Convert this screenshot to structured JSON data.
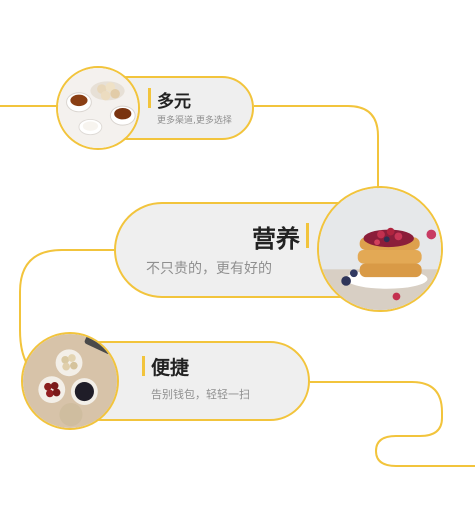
{
  "colors": {
    "accent": "#f2c43c",
    "pill": "#efefef",
    "title": "#222222",
    "subtitle": "#8f8f8f"
  },
  "items": [
    {
      "title": "多元",
      "subtitle": "更多渠道,更多选择",
      "image": "tea-and-snacks-photo"
    },
    {
      "title": "营养",
      "subtitle": "不只贵的，更有好的",
      "image": "waffles-with-berries-photo"
    },
    {
      "title": "便捷",
      "subtitle": "告别钱包，轻轻一扫",
      "image": "snack-bowls-photo"
    }
  ]
}
